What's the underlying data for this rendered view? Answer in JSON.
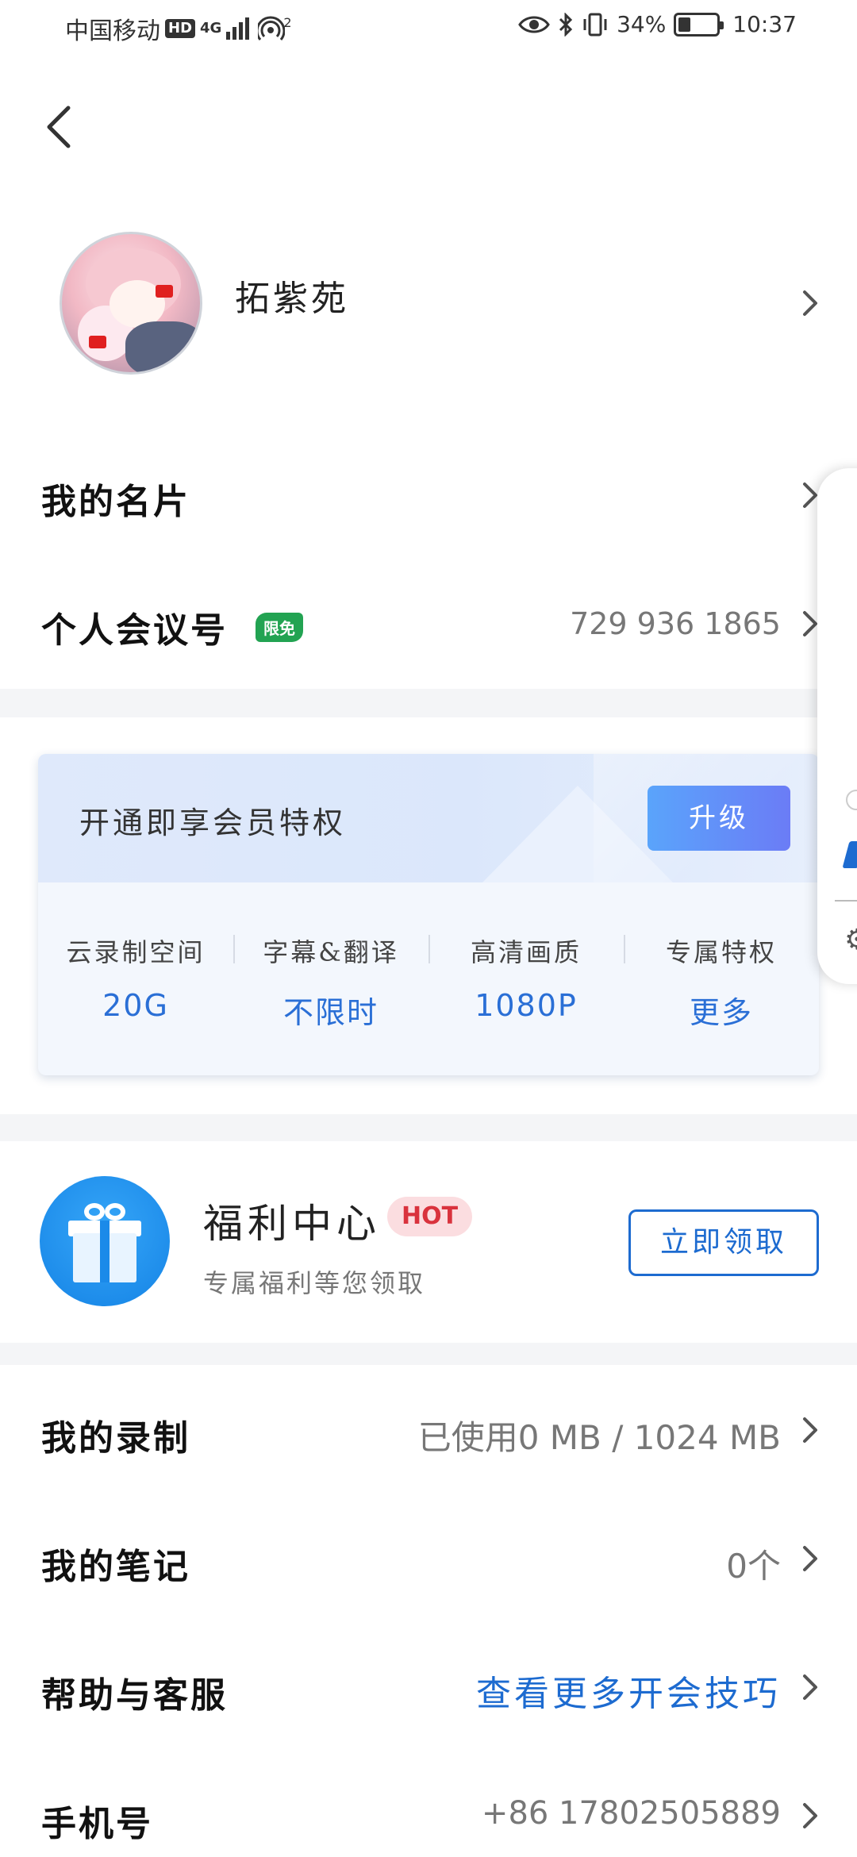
{
  "status_bar": {
    "carrier": "中国移动",
    "hd": "HD",
    "network": "4G",
    "hotspot_sub": "2",
    "battery": "34%",
    "time": "10:37"
  },
  "profile": {
    "username": "拓紫苑"
  },
  "rows": {
    "business_card": {
      "title": "我的名片"
    },
    "meeting_id": {
      "title": "个人会议号",
      "badge": "限免",
      "value": "729 936 1865"
    }
  },
  "vip": {
    "title": "开通即享会员特权",
    "upgrade_label": "升级",
    "perks": [
      {
        "label": "云录制空间",
        "value": "20G"
      },
      {
        "label": "字幕&翻译",
        "value": "不限时"
      },
      {
        "label": "高清画质",
        "value": "1080P"
      },
      {
        "label": "专属特权",
        "value": "更多"
      }
    ]
  },
  "welfare": {
    "title": "福利中心",
    "hot": "HOT",
    "subtitle": "专属福利等您领取",
    "claim_label": "立即领取"
  },
  "menu": {
    "recordings": {
      "title": "我的录制",
      "value": "已使用0 MB / 1024 MB"
    },
    "notes": {
      "title": "我的笔记",
      "value": "0个"
    },
    "help": {
      "title": "帮助与客服",
      "value": "查看更多开会技巧"
    },
    "phone": {
      "title": "手机号",
      "value": "+86 17802505889"
    }
  },
  "colors": {
    "accent_blue": "#2a6fd6",
    "link_blue": "#1d6bd0",
    "free_badge": "#22a352",
    "hot_badge_text": "#d9323d",
    "hot_badge_bg": "#fbdde0"
  }
}
